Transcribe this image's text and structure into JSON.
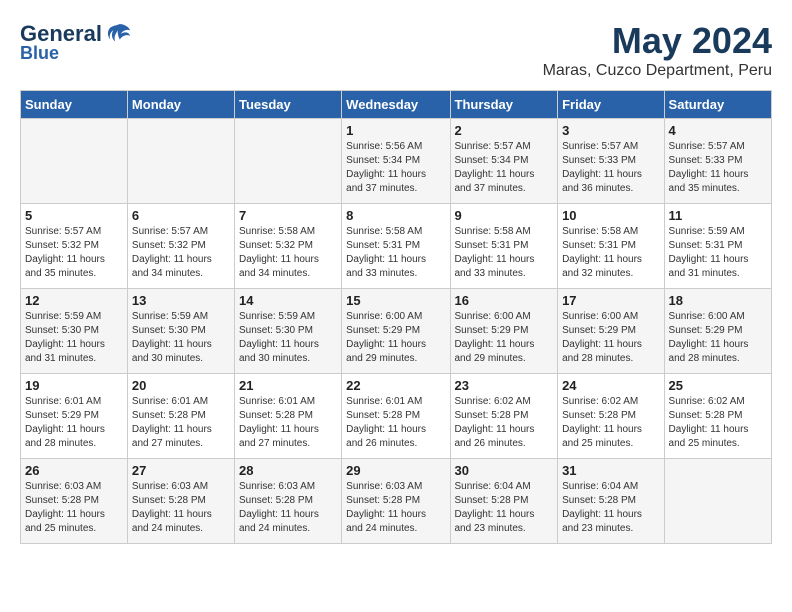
{
  "header": {
    "logo_line1": "General",
    "logo_line2": "Blue",
    "month_title": "May 2024",
    "location": "Maras, Cuzco Department, Peru"
  },
  "weekdays": [
    "Sunday",
    "Monday",
    "Tuesday",
    "Wednesday",
    "Thursday",
    "Friday",
    "Saturday"
  ],
  "weeks": [
    [
      {
        "day": "",
        "info": ""
      },
      {
        "day": "",
        "info": ""
      },
      {
        "day": "",
        "info": ""
      },
      {
        "day": "1",
        "info": "Sunrise: 5:56 AM\nSunset: 5:34 PM\nDaylight: 11 hours\nand 37 minutes."
      },
      {
        "day": "2",
        "info": "Sunrise: 5:57 AM\nSunset: 5:34 PM\nDaylight: 11 hours\nand 37 minutes."
      },
      {
        "day": "3",
        "info": "Sunrise: 5:57 AM\nSunset: 5:33 PM\nDaylight: 11 hours\nand 36 minutes."
      },
      {
        "day": "4",
        "info": "Sunrise: 5:57 AM\nSunset: 5:33 PM\nDaylight: 11 hours\nand 35 minutes."
      }
    ],
    [
      {
        "day": "5",
        "info": "Sunrise: 5:57 AM\nSunset: 5:32 PM\nDaylight: 11 hours\nand 35 minutes."
      },
      {
        "day": "6",
        "info": "Sunrise: 5:57 AM\nSunset: 5:32 PM\nDaylight: 11 hours\nand 34 minutes."
      },
      {
        "day": "7",
        "info": "Sunrise: 5:58 AM\nSunset: 5:32 PM\nDaylight: 11 hours\nand 34 minutes."
      },
      {
        "day": "8",
        "info": "Sunrise: 5:58 AM\nSunset: 5:31 PM\nDaylight: 11 hours\nand 33 minutes."
      },
      {
        "day": "9",
        "info": "Sunrise: 5:58 AM\nSunset: 5:31 PM\nDaylight: 11 hours\nand 33 minutes."
      },
      {
        "day": "10",
        "info": "Sunrise: 5:58 AM\nSunset: 5:31 PM\nDaylight: 11 hours\nand 32 minutes."
      },
      {
        "day": "11",
        "info": "Sunrise: 5:59 AM\nSunset: 5:31 PM\nDaylight: 11 hours\nand 31 minutes."
      }
    ],
    [
      {
        "day": "12",
        "info": "Sunrise: 5:59 AM\nSunset: 5:30 PM\nDaylight: 11 hours\nand 31 minutes."
      },
      {
        "day": "13",
        "info": "Sunrise: 5:59 AM\nSunset: 5:30 PM\nDaylight: 11 hours\nand 30 minutes."
      },
      {
        "day": "14",
        "info": "Sunrise: 5:59 AM\nSunset: 5:30 PM\nDaylight: 11 hours\nand 30 minutes."
      },
      {
        "day": "15",
        "info": "Sunrise: 6:00 AM\nSunset: 5:29 PM\nDaylight: 11 hours\nand 29 minutes."
      },
      {
        "day": "16",
        "info": "Sunrise: 6:00 AM\nSunset: 5:29 PM\nDaylight: 11 hours\nand 29 minutes."
      },
      {
        "day": "17",
        "info": "Sunrise: 6:00 AM\nSunset: 5:29 PM\nDaylight: 11 hours\nand 28 minutes."
      },
      {
        "day": "18",
        "info": "Sunrise: 6:00 AM\nSunset: 5:29 PM\nDaylight: 11 hours\nand 28 minutes."
      }
    ],
    [
      {
        "day": "19",
        "info": "Sunrise: 6:01 AM\nSunset: 5:29 PM\nDaylight: 11 hours\nand 28 minutes."
      },
      {
        "day": "20",
        "info": "Sunrise: 6:01 AM\nSunset: 5:28 PM\nDaylight: 11 hours\nand 27 minutes."
      },
      {
        "day": "21",
        "info": "Sunrise: 6:01 AM\nSunset: 5:28 PM\nDaylight: 11 hours\nand 27 minutes."
      },
      {
        "day": "22",
        "info": "Sunrise: 6:01 AM\nSunset: 5:28 PM\nDaylight: 11 hours\nand 26 minutes."
      },
      {
        "day": "23",
        "info": "Sunrise: 6:02 AM\nSunset: 5:28 PM\nDaylight: 11 hours\nand 26 minutes."
      },
      {
        "day": "24",
        "info": "Sunrise: 6:02 AM\nSunset: 5:28 PM\nDaylight: 11 hours\nand 25 minutes."
      },
      {
        "day": "25",
        "info": "Sunrise: 6:02 AM\nSunset: 5:28 PM\nDaylight: 11 hours\nand 25 minutes."
      }
    ],
    [
      {
        "day": "26",
        "info": "Sunrise: 6:03 AM\nSunset: 5:28 PM\nDaylight: 11 hours\nand 25 minutes."
      },
      {
        "day": "27",
        "info": "Sunrise: 6:03 AM\nSunset: 5:28 PM\nDaylight: 11 hours\nand 24 minutes."
      },
      {
        "day": "28",
        "info": "Sunrise: 6:03 AM\nSunset: 5:28 PM\nDaylight: 11 hours\nand 24 minutes."
      },
      {
        "day": "29",
        "info": "Sunrise: 6:03 AM\nSunset: 5:28 PM\nDaylight: 11 hours\nand 24 minutes."
      },
      {
        "day": "30",
        "info": "Sunrise: 6:04 AM\nSunset: 5:28 PM\nDaylight: 11 hours\nand 23 minutes."
      },
      {
        "day": "31",
        "info": "Sunrise: 6:04 AM\nSunset: 5:28 PM\nDaylight: 11 hours\nand 23 minutes."
      },
      {
        "day": "",
        "info": ""
      }
    ]
  ]
}
